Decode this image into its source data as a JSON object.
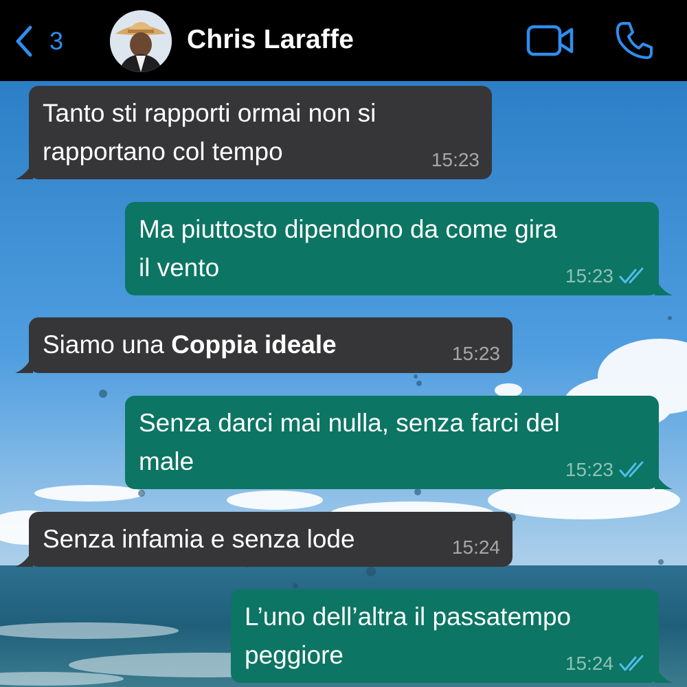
{
  "header": {
    "back_count": "3",
    "contact_name": "Chris Laraffe",
    "icons": [
      "chevron-left-icon",
      "video-camera-icon",
      "phone-icon"
    ],
    "accent_color": "#2f8ef0"
  },
  "colors": {
    "incoming_bubble": "#363638",
    "outgoing_bubble": "#0c7563",
    "read_ticks": "#53bdeb"
  },
  "messages": [
    {
      "direction": "incoming",
      "text": "Tanto sti rapporti ormai non si\nrapportano col tempo",
      "time": "15:23"
    },
    {
      "direction": "outgoing",
      "text": "Ma piuttosto dipendono da come gira\nil vento",
      "time": "15:23",
      "status": "read"
    },
    {
      "direction": "incoming",
      "text_plain": "Siamo una ",
      "text_bold": "Coppia ideale",
      "time": "15:23"
    },
    {
      "direction": "outgoing",
      "text": "Senza darci mai nulla, senza farci del\nmale",
      "time": "15:23",
      "status": "read"
    },
    {
      "direction": "incoming",
      "text": "Senza infamia e senza lode",
      "time": "15:24"
    },
    {
      "direction": "outgoing",
      "text": "L’uno dell’altra il passatempo\npeggiore",
      "time": "15:24",
      "status": "read"
    }
  ]
}
